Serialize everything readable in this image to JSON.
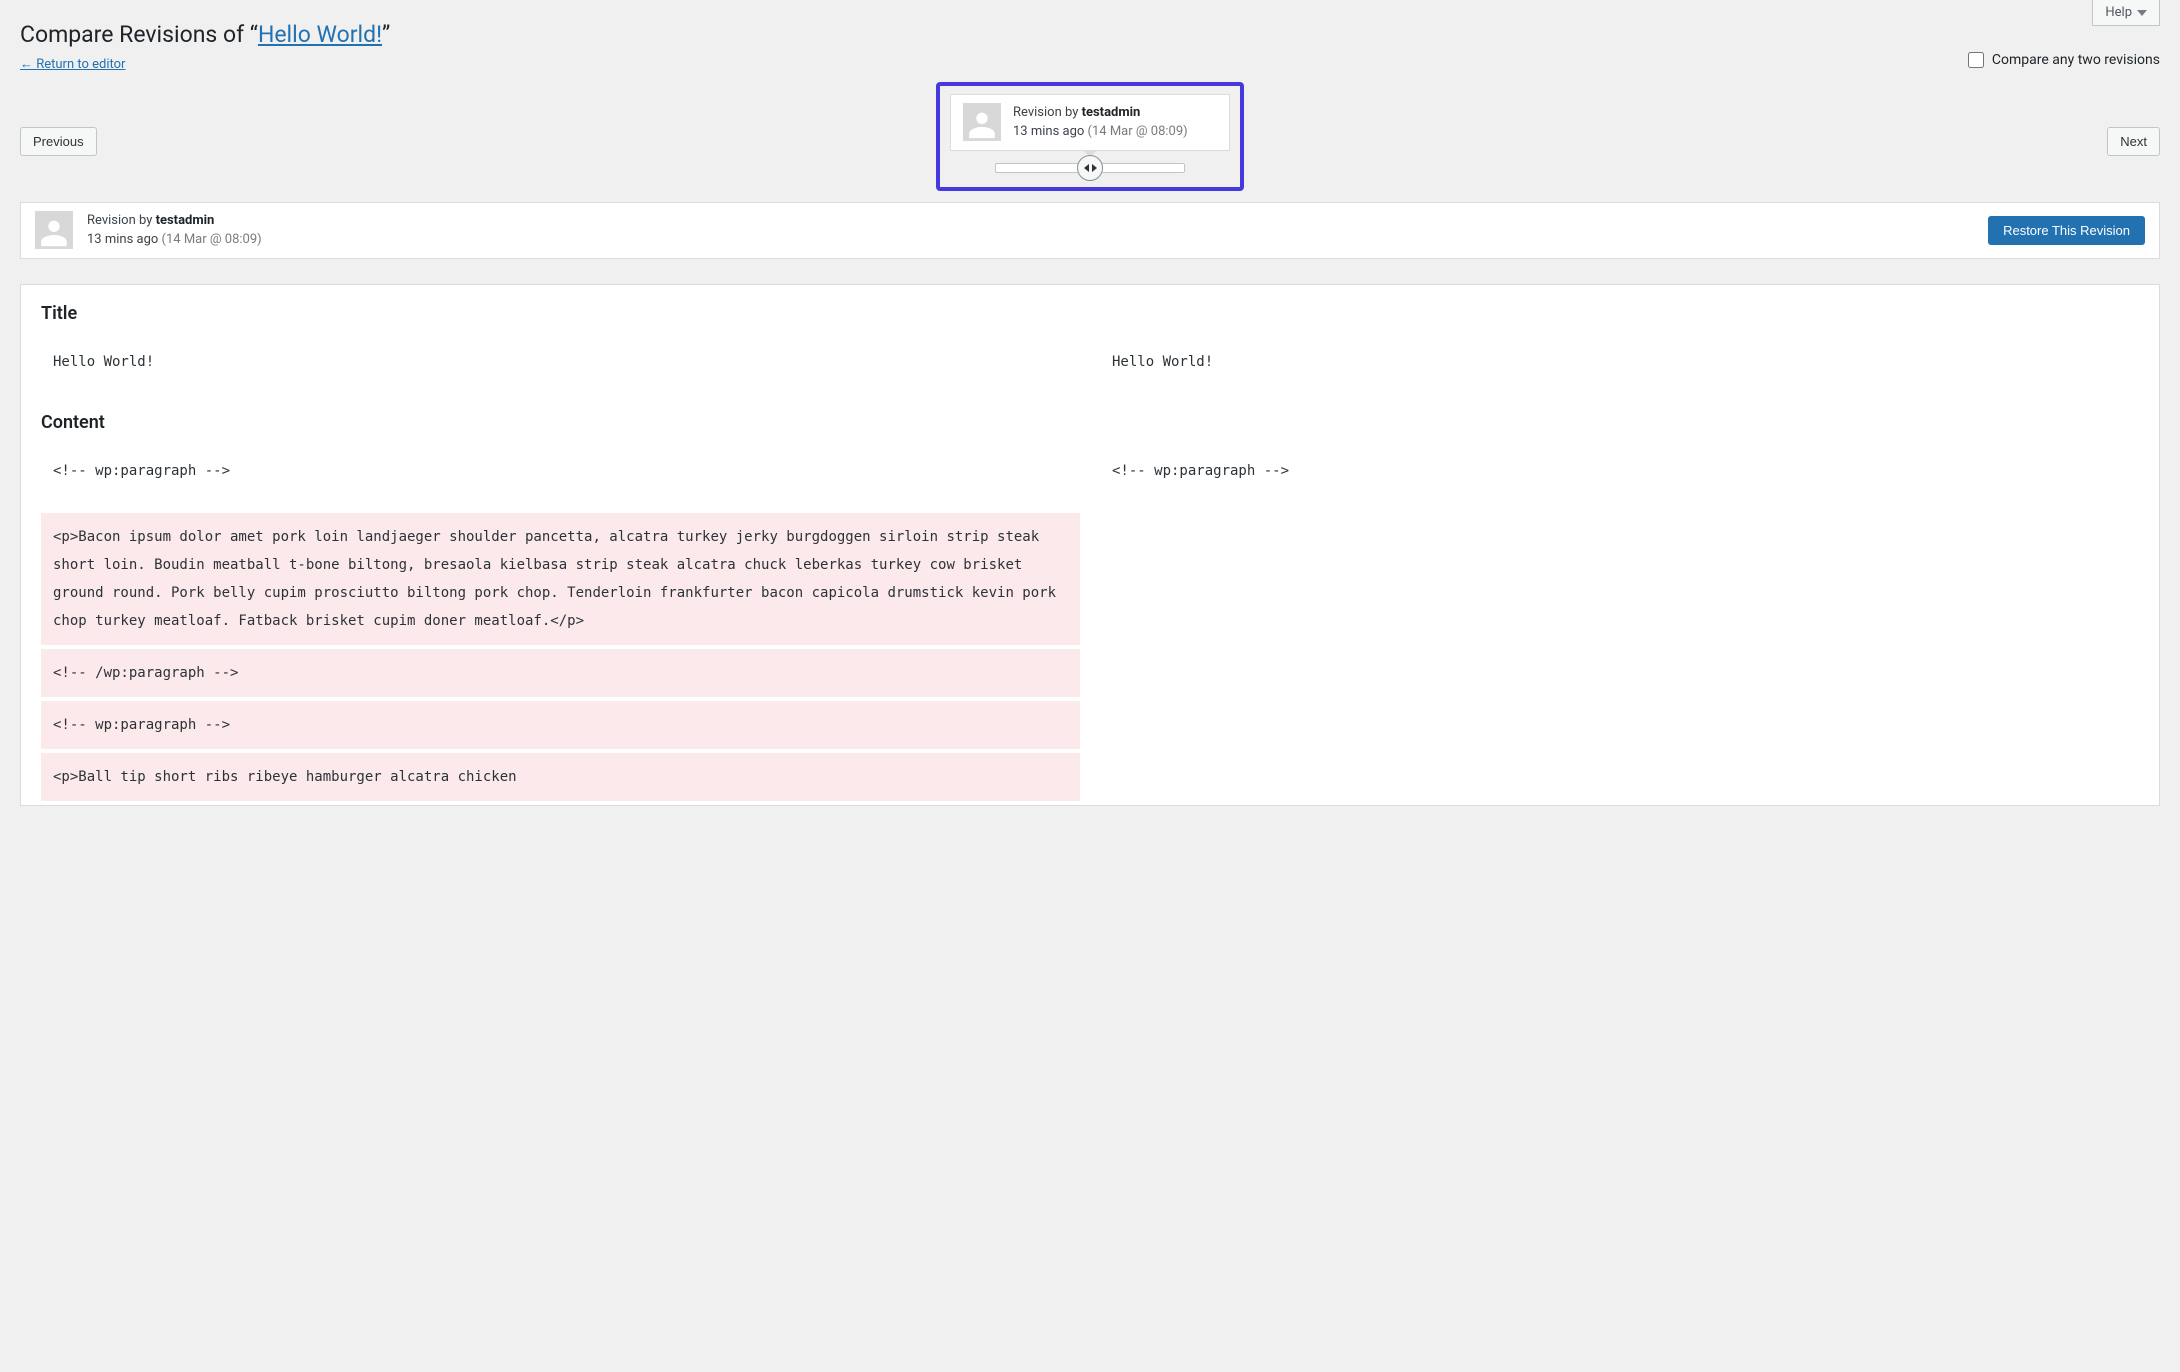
{
  "help": {
    "label": "Help"
  },
  "page": {
    "title_prefix": "Compare Revisions of “",
    "post_title": "Hello World!",
    "title_suffix": "”",
    "return_link": "← Return to editor"
  },
  "compare_check": {
    "label": "Compare any two revisions"
  },
  "nav": {
    "prev": "Previous",
    "next": "Next"
  },
  "tooltip": {
    "by_label": "Revision by ",
    "author": "testadmin",
    "ago": "13 mins ago",
    "datetime": "(14 Mar @ 08:09)"
  },
  "meta": {
    "by_label": "Revision by ",
    "author": "testadmin",
    "ago": "13 mins ago",
    "datetime": "(14 Mar @ 08:09)",
    "restore_label": "Restore This Revision"
  },
  "diff": {
    "title_heading": "Title",
    "content_heading": "Content",
    "title_left": "Hello World!",
    "title_right": "Hello World!",
    "content_rows": [
      {
        "type": "context",
        "left": "<!-- wp:paragraph -->",
        "right": "<!-- wp:paragraph -->"
      },
      {
        "type": "removed",
        "left": "<p>Bacon ipsum dolor amet pork loin landjaeger shoulder pancetta, alcatra turkey jerky burgdoggen sirloin strip steak short loin. Boudin meatball t-bone biltong, bresaola kielbasa strip steak alcatra chuck leberkas turkey cow brisket ground round. Pork belly cupim prosciutto biltong pork chop. Tenderloin frankfurter bacon capicola drumstick kevin pork chop turkey meatloaf. Fatback brisket cupim doner meatloaf.</p>",
        "right": ""
      },
      {
        "type": "removed",
        "left": "<!-- /wp:paragraph -->",
        "right": ""
      },
      {
        "type": "removed",
        "left": "<!-- wp:paragraph -->",
        "right": ""
      },
      {
        "type": "removed",
        "left": "<p>Ball tip short ribs ribeye hamburger alcatra chicken",
        "right": ""
      }
    ]
  }
}
